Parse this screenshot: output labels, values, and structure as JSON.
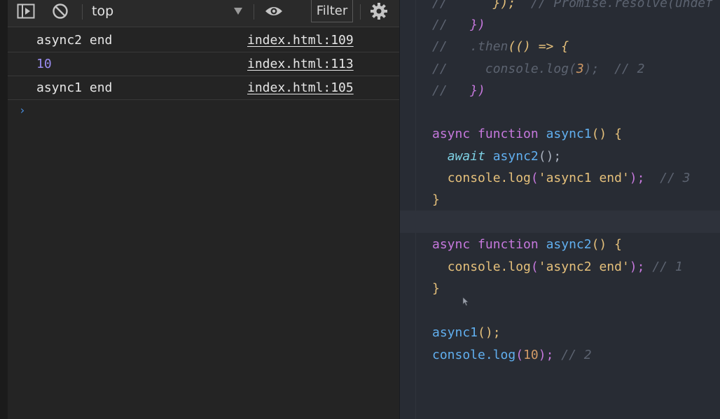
{
  "toolbar": {
    "context": "top",
    "filter_label": "Filter"
  },
  "console_rows": [
    {
      "message": "async2 end",
      "source": "index.html:109"
    },
    {
      "message": "10",
      "source": "index.html:113"
    },
    {
      "message": "async1 end",
      "source": "index.html:105"
    }
  ],
  "prompt_symbol": "›",
  "editor": {
    "line1_a": "//      ",
    "line1_b": "});",
    "line1_c": "  // Promise.resolve(undef",
    "line2_a": "//   ",
    "line2_b": "})",
    "line3_a": "//   .then",
    "line3_b": "(() => {",
    "line4_a": "//     console.log(",
    "line4_b": "3",
    "line4_c": ");  // 2",
    "line5_a": "//   ",
    "line5_b": "})",
    "fn1_kw": "async function ",
    "fn1_name": "async1",
    "fn1_paren": "() ",
    "fn1_brace": "{",
    "fn1_await": "await ",
    "fn1_call": "async2",
    "fn1_call_p": "();",
    "fn1_log": "console.log",
    "fn1_log_open": "(",
    "fn1_log_str": "'async1 end'",
    "fn1_log_close": ");",
    "fn1_log_cm": "  // 3",
    "fn1_end": "}",
    "fn2_kw": "async function ",
    "fn2_name": "async2",
    "fn2_paren": "() ",
    "fn2_brace": "{",
    "fn2_log": "console.log",
    "fn2_log_open": "(",
    "fn2_log_str": "'async2 end'",
    "fn2_log_close": ");",
    "fn2_log_cm": " // 1",
    "fn2_end": "}",
    "call1": "async1",
    "call1_p": "();",
    "call2_log": "console.log",
    "call2_open": "(",
    "call2_num": "10",
    "call2_close": ");",
    "call2_cm": " // 2"
  }
}
